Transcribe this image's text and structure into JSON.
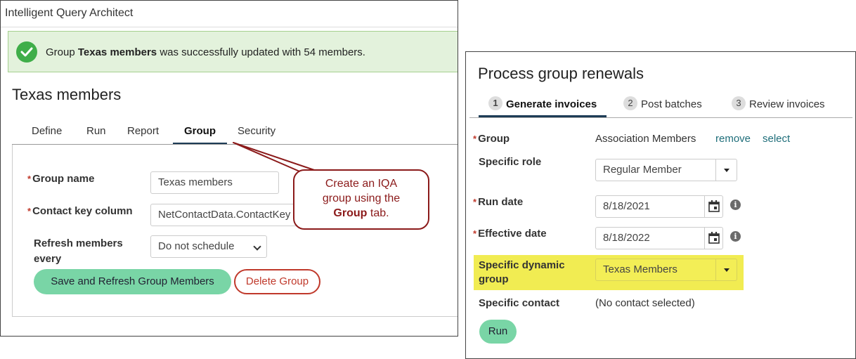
{
  "iqa": {
    "app_title": "Intelligent Query Architect",
    "alert": {
      "prefix": "Group ",
      "group": "Texas members",
      "suffix": " was successfully updated with 54 members."
    },
    "page_title": "Texas members",
    "tabs": [
      {
        "label": "Define"
      },
      {
        "label": "Run"
      },
      {
        "label": "Report"
      },
      {
        "label": "Group",
        "active": true
      },
      {
        "label": "Security"
      }
    ],
    "form": {
      "group_name_label": "Group name",
      "group_name_value": "Texas members",
      "contact_key_label": "Contact key column",
      "contact_key_value": "NetContactData.ContactKey",
      "refresh_label_1": "Refresh members",
      "refresh_label_2": "every",
      "refresh_value": "Do not schedule",
      "required_mark": "*"
    },
    "buttons": {
      "save": "Save and Refresh Group Members",
      "delete": "Delete Group"
    },
    "callout": {
      "line1": "Create an IQA",
      "line2": "group using the",
      "bold": "Group",
      "line3_suffix": " tab."
    }
  },
  "renewals": {
    "title": "Process group renewals",
    "steps": [
      {
        "num": "1",
        "label": "Generate invoices",
        "active": true
      },
      {
        "num": "2",
        "label": "Post batches"
      },
      {
        "num": "3",
        "label": "Review invoices"
      }
    ],
    "fields": {
      "group_label": "Group",
      "group_value": "Association Members",
      "remove_link": "remove",
      "select_link": "select",
      "role_label": "Specific role",
      "role_value": "Regular Member",
      "run_date_label": "Run date",
      "run_date_value": "8/18/2021",
      "effective_date_label": "Effective date",
      "effective_date_value": "8/18/2022",
      "dyn_group_label_1": "Specific dynamic",
      "dyn_group_label_2": "group",
      "dyn_group_value": "Texas Members",
      "contact_label": "Specific contact",
      "contact_value": "(No contact selected)",
      "required_mark": "*",
      "info_glyph": "i"
    },
    "run_button": "Run"
  },
  "colors": {
    "success_bg": "#e3f2dc",
    "success_icon": "#3fae49",
    "primary_button": "#79d5a6",
    "danger": "#c0392b",
    "callout": "#8b1a1a",
    "highlight": "#f1ec52",
    "link": "#1f6e7a",
    "tab_underline": "#1d3c56"
  }
}
